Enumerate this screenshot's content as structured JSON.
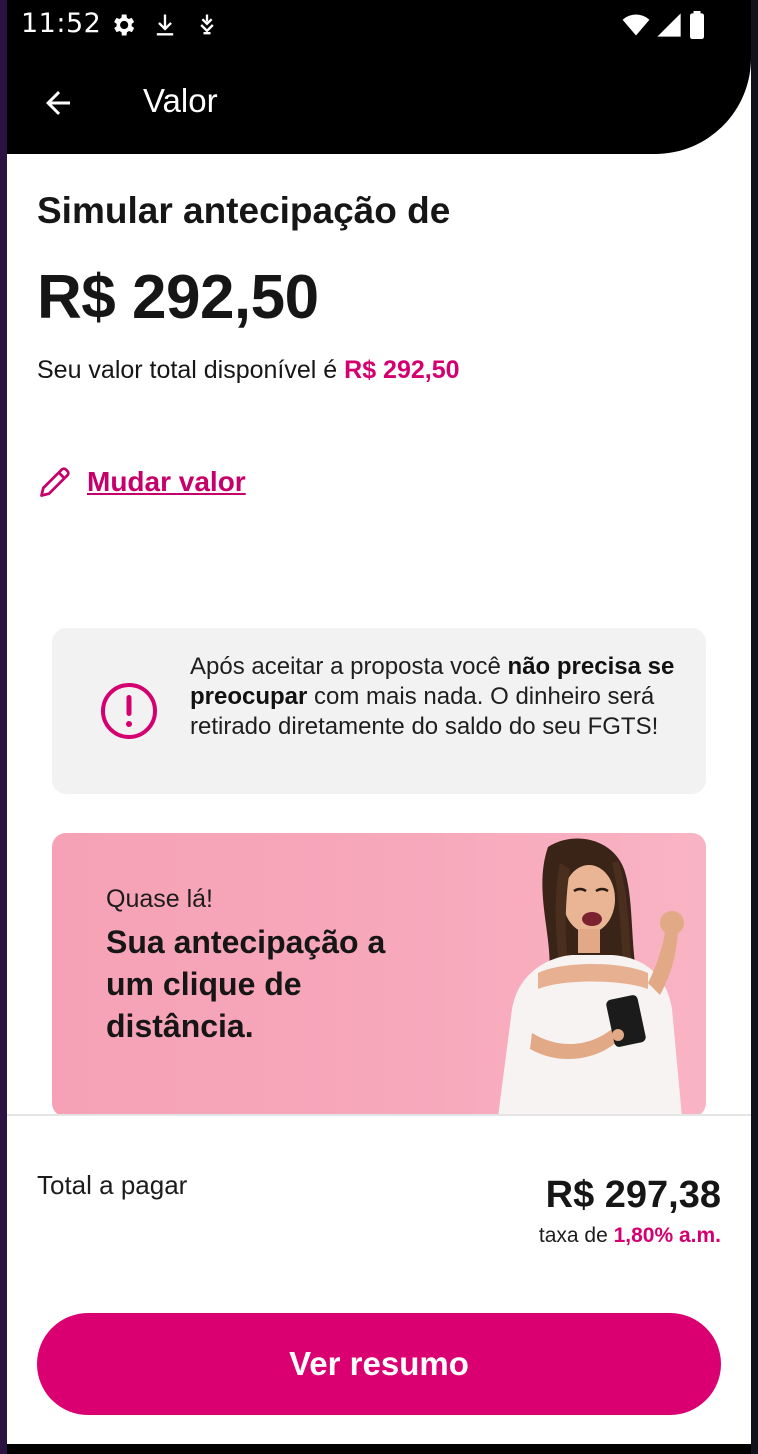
{
  "status_bar": {
    "time": "11:52",
    "icons_left": [
      "gear-icon",
      "download-icon",
      "download-alt-icon"
    ],
    "icons_right": [
      "wifi-icon",
      "signal-icon",
      "battery-icon"
    ]
  },
  "app_bar": {
    "title": "Valor",
    "back_icon": "arrow-left-icon"
  },
  "main": {
    "headline": "Simular antecipação de",
    "amount": "R$ 292,50",
    "available_prefix": "Seu valor total disponível é ",
    "available_amount": "R$ 292,50",
    "change_value_label": "Mudar valor",
    "change_value_icon": "pencil-icon"
  },
  "info_card": {
    "icon": "alert-circle-icon",
    "text_1": "Após aceitar a proposta você ",
    "text_bold": "não precisa se preocupar",
    "text_2": " com mais nada. O dinheiro será retirado diretamente do saldo do seu FGTS!"
  },
  "promo": {
    "subtitle": "Quase lá!",
    "title": "Sua antecipação a um clique de distância."
  },
  "footer": {
    "total_label": "Total a pagar",
    "total_value": "R$ 297,38",
    "rate_prefix": "taxa de ",
    "rate_value": "1,80% a.m.",
    "button_label": "Ver resumo"
  },
  "colors": {
    "accent": "#db0072",
    "accent_text": "#d4006f",
    "banner": "#f7a8bb",
    "card_bg": "#f2f2f2"
  }
}
